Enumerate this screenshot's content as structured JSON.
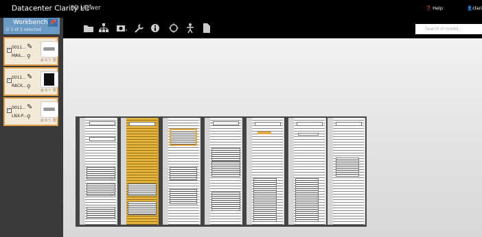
{
  "app": {
    "brand": "Datacenter Clarity LC",
    "brand_mark": "*",
    "viewer_title": "3D Viewer"
  },
  "header": {
    "help_label": "Help",
    "user_label": "clarity"
  },
  "search": {
    "placeholder": "Search in model..."
  },
  "toolbar": {
    "icons": [
      "folder-icon",
      "hierarchy-icon",
      "camera-icon",
      "wrench-icon",
      "info-icon",
      "target-icon",
      "person-icon",
      "document-icon"
    ]
  },
  "workbench": {
    "title": "Workbench",
    "selection_text": "3 of 3 selected",
    "items": [
      {
        "id": "0011...",
        "name": "MAIL...",
        "thumb": "server-thumb"
      },
      {
        "id": "0011...",
        "name": "RACK...",
        "thumb": "rack-thumb"
      },
      {
        "id": "0011...",
        "name": "LNX-P...",
        "thumb": "server-thumb"
      }
    ]
  },
  "colors": {
    "accent": "#6b9ac4",
    "selection": "#e2a04b",
    "rack_selected": "#d8a124"
  },
  "racks": [
    {
      "selected": false
    },
    {
      "selected": true
    },
    {
      "selected": false
    },
    {
      "selected": false
    },
    {
      "selected": false
    },
    {
      "selected": false
    },
    {
      "selected": false
    }
  ]
}
